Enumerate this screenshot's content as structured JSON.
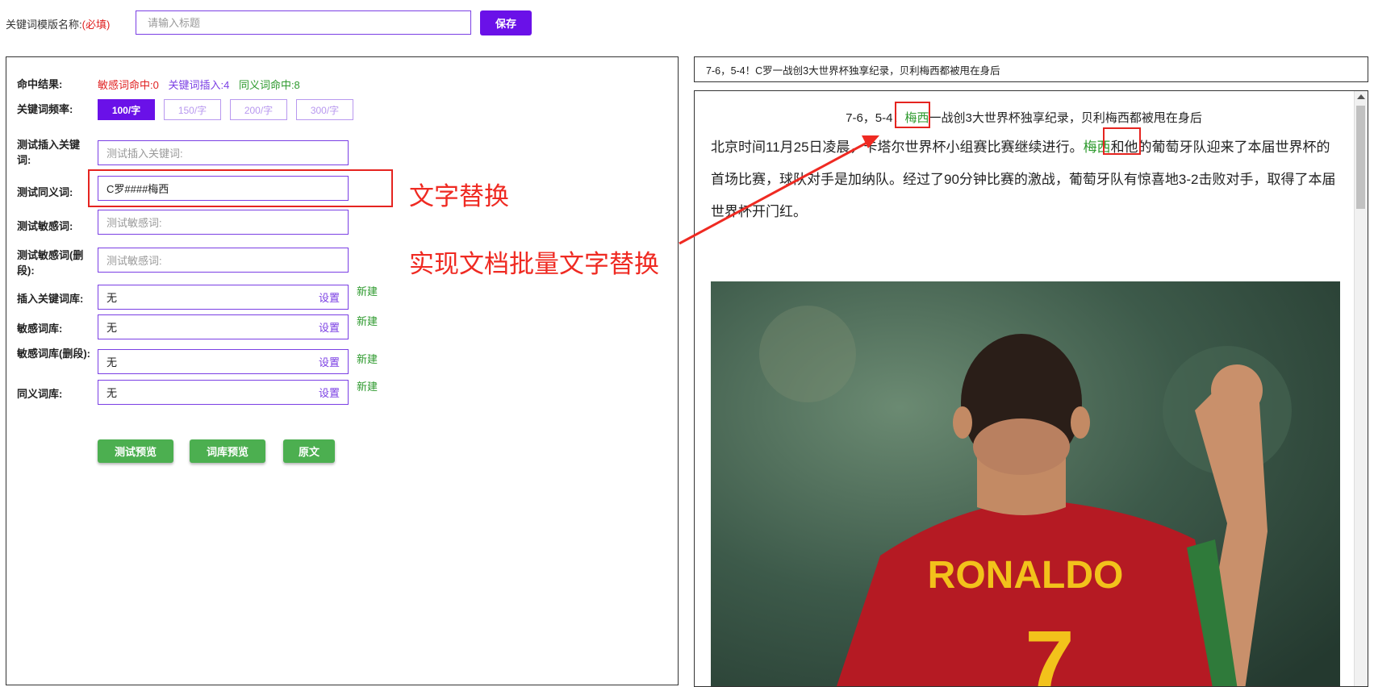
{
  "header": {
    "name_label": "关键词模版名称:",
    "required_mark": "(必填)",
    "title_placeholder": "请输入标题",
    "save_label": "保存"
  },
  "form": {
    "hit_label": "命中结果:",
    "hits": {
      "sensitive": "敏感词命中:0",
      "keyword_insert": "关键词插入:4",
      "synonym": "同义词命中:8"
    },
    "freq_label": "关键词频率:",
    "freq_options": [
      "100/字",
      "150/字",
      "200/字",
      "300/字"
    ],
    "test_insert_label": "测试插入关键词:",
    "test_insert_placeholder": "测试插入关键词:",
    "test_synonym_label": "测试同义词:",
    "test_synonym_value": "C罗####梅西",
    "test_sensitive_label": "测试敏感词:",
    "test_sensitive_placeholder": "测试敏感词:",
    "test_sensitive_del_label": "测试敏感词(删段):",
    "test_sensitive_del_placeholder": "测试敏感词:",
    "insert_lib_label": "插入关键词库:",
    "sensitive_lib_label": "敏感词库:",
    "sensitive_del_lib_label": "敏感词库(删段):",
    "synonym_lib_label": "同义词库:",
    "lib_value": "无",
    "set_label": "设置",
    "new_label": "新建",
    "buttons": {
      "test_preview": "测试预览",
      "lib_preview": "词库预览",
      "original": "原文"
    }
  },
  "annotations": {
    "replace": "文字替换",
    "batch": "实现文档批量文字替换"
  },
  "preview": {
    "title_bar": "7-6，5-4！C罗一战创3大世界杯独享纪录，贝利梅西都被甩在身后",
    "doc_title_pre": "7-6，5-4！",
    "doc_title_hl": "梅西",
    "doc_title_post": "一战创3大世界杯独享纪录，贝利梅西都被甩在身后",
    "body_pre": "北京时间11月25日凌晨，卡塔尔世界杯小组赛比赛继续进行。",
    "body_hl": "梅西",
    "body_post": "和他的葡萄牙队迎来了本届世界杯的首场比赛，球队对手是加纳队。经过了90分钟比赛的激战，葡萄牙队有惊喜地3-2击败对手，取得了本届世界杯开门红。",
    "jersey_name": "RONALDO",
    "jersey_number": "7"
  },
  "colors": {
    "accent": "#6a11e8",
    "green": "#4caf50",
    "annotation_red": "#ef2a22"
  }
}
